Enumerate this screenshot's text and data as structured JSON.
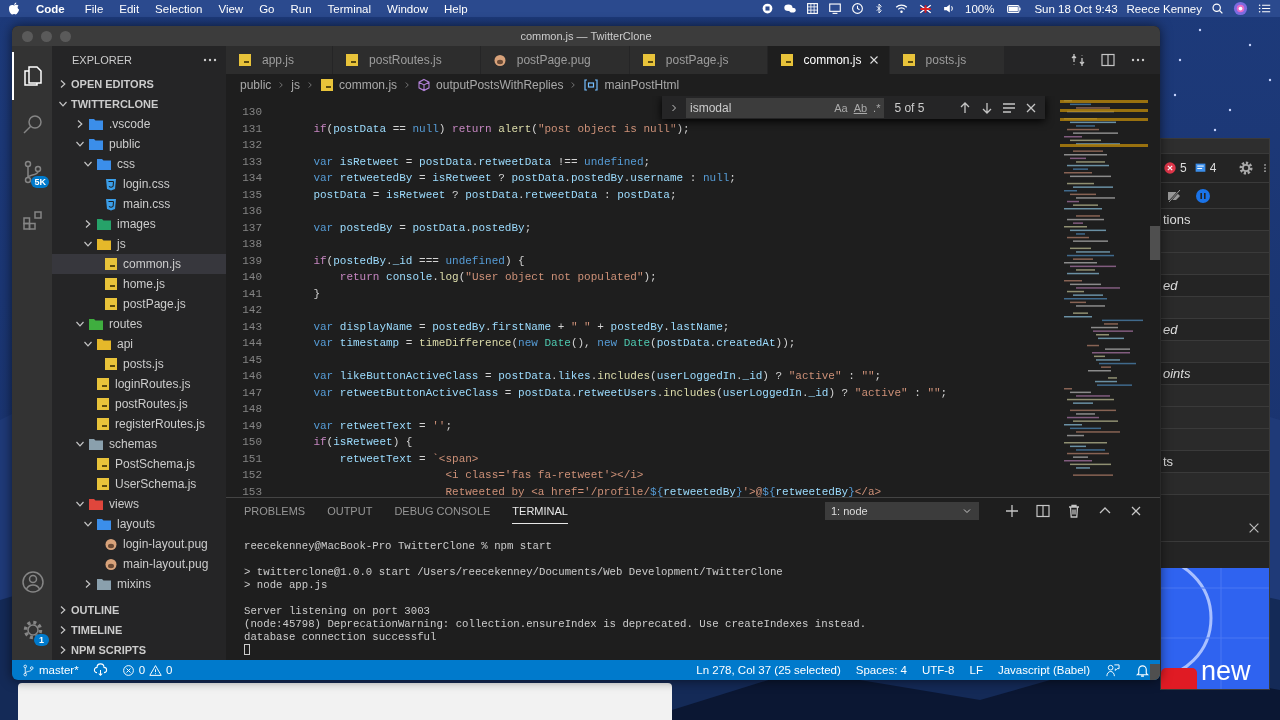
{
  "menubar": {
    "app_name": "Code",
    "menus": [
      "File",
      "Edit",
      "Selection",
      "View",
      "Go",
      "Run",
      "Terminal",
      "Window",
      "Help"
    ],
    "battery": "100%",
    "clock": "Sun 18 Oct 9:43",
    "user": "Reece Kenney"
  },
  "window": {
    "title": "common.js — TwitterClone"
  },
  "activity_bar": {
    "items": [
      {
        "kind": "explorer",
        "selected": true
      },
      {
        "kind": "search",
        "selected": false
      },
      {
        "kind": "source-control",
        "selected": false,
        "badge": "5K"
      },
      {
        "kind": "extensions",
        "selected": false
      }
    ],
    "settings_badge": "1"
  },
  "sidebar": {
    "title": "EXPLORER",
    "sections": [
      {
        "label": "OPEN EDITORS",
        "expanded": false
      },
      {
        "label": "TWITTERCLONE",
        "expanded": true,
        "tree": [
          {
            "name": ".vscode",
            "kind": "folder",
            "color": "#3b8eea",
            "expanded": false,
            "selected": false
          },
          {
            "name": "public",
            "kind": "folder",
            "color": "#3b8eea",
            "expanded": true,
            "selected": false,
            "children": [
              {
                "name": "css",
                "kind": "folder",
                "color": "#3b8eea",
                "expanded": true,
                "selected": false,
                "children": [
                  {
                    "name": "login.css",
                    "kind": "css",
                    "selected": false
                  },
                  {
                    "name": "main.css",
                    "kind": "css",
                    "selected": false
                  }
                ]
              },
              {
                "name": "images",
                "kind": "folder",
                "color": "#26a269",
                "expanded": false,
                "selected": false
              },
              {
                "name": "js",
                "kind": "folder",
                "color": "#e5b82a",
                "expanded": true,
                "selected": false,
                "children": [
                  {
                    "name": "common.js",
                    "kind": "js",
                    "selected": true
                  },
                  {
                    "name": "home.js",
                    "kind": "js",
                    "selected": false
                  },
                  {
                    "name": "postPage.js",
                    "kind": "js",
                    "selected": false
                  }
                ]
              }
            ]
          },
          {
            "name": "routes",
            "kind": "folder",
            "color": "#3fae3f",
            "expanded": true,
            "selected": false,
            "children": [
              {
                "name": "api",
                "kind": "folder",
                "color": "#e5b82a",
                "expanded": true,
                "selected": false,
                "children": [
                  {
                    "name": "posts.js",
                    "kind": "js",
                    "selected": false
                  }
                ]
              },
              {
                "name": "loginRoutes.js",
                "kind": "js",
                "selected": false
              },
              {
                "name": "postRoutes.js",
                "kind": "js",
                "selected": false
              },
              {
                "name": "registerRoutes.js",
                "kind": "js",
                "selected": false
              }
            ]
          },
          {
            "name": "schemas",
            "kind": "folder",
            "color": "#8aa0ad",
            "expanded": true,
            "selected": false,
            "children": [
              {
                "name": "PostSchema.js",
                "kind": "js",
                "selected": false
              },
              {
                "name": "UserSchema.js",
                "kind": "js",
                "selected": false
              }
            ]
          },
          {
            "name": "views",
            "kind": "folder",
            "color": "#e0463c",
            "expanded": true,
            "selected": false,
            "children": [
              {
                "name": "layouts",
                "kind": "folder",
                "color": "#3b8eea",
                "expanded": true,
                "selected": false,
                "children": [
                  {
                    "name": "login-layout.pug",
                    "kind": "pug",
                    "selected": false
                  },
                  {
                    "name": "main-layout.pug",
                    "kind": "pug",
                    "selected": false
                  }
                ]
              },
              {
                "name": "mixins",
                "kind": "folder",
                "color": "#8aa0ad",
                "expanded": false,
                "selected": false
              }
            ]
          }
        ]
      },
      {
        "label": "OUTLINE",
        "expanded": false
      },
      {
        "label": "TIMELINE",
        "expanded": false
      },
      {
        "label": "NPM SCRIPTS",
        "expanded": false
      }
    ]
  },
  "tabs": [
    {
      "label": "app.js",
      "kind": "js",
      "selected": false
    },
    {
      "label": "postRoutes.js",
      "kind": "js",
      "selected": false
    },
    {
      "label": "postPage.pug",
      "kind": "pug",
      "selected": false
    },
    {
      "label": "postPage.js",
      "kind": "js",
      "selected": false
    },
    {
      "label": "common.js",
      "kind": "js",
      "selected": true
    },
    {
      "label": "posts.js",
      "kind": "js",
      "selected": false
    }
  ],
  "breadcrumb": [
    {
      "label": "public",
      "kind": "folder"
    },
    {
      "label": "js",
      "kind": "folder"
    },
    {
      "label": "common.js",
      "kind": "js"
    },
    {
      "label": "outputPostsWithReplies",
      "kind": "method"
    },
    {
      "label": "mainPostHtml",
      "kind": "variable"
    }
  ],
  "find_widget": {
    "value": "ismodal",
    "options": [
      "Aa",
      "Ab",
      ".*"
    ],
    "match_count": "5 of 5"
  },
  "editor": {
    "lines": [
      {
        "n": "130"
      },
      {
        "n": "131",
        "tokens": [
          {
            "kind": "c",
            "text": "    if"
          },
          {
            "text": "("
          },
          {
            "kind": "v",
            "text": "postData"
          },
          {
            "text": " == "
          },
          {
            "kind": "k",
            "text": "null"
          },
          {
            "text": ") "
          },
          {
            "kind": "c",
            "text": "return "
          },
          {
            "kind": "f",
            "text": "alert"
          },
          {
            "text": "("
          },
          {
            "kind": "s",
            "text": "\"post object is null\""
          },
          {
            "text": ");"
          }
        ]
      },
      {
        "n": "132"
      },
      {
        "n": "133",
        "tokens": [
          {
            "kind": "k",
            "text": "    var "
          },
          {
            "kind": "v",
            "text": "isRetweet"
          },
          {
            "text": " = "
          },
          {
            "kind": "v",
            "text": "postData"
          },
          {
            "text": "."
          },
          {
            "kind": "v",
            "text": "retweetData"
          },
          {
            "text": " !== "
          },
          {
            "kind": "k",
            "text": "undefined"
          },
          {
            "text": ";"
          }
        ]
      },
      {
        "n": "134",
        "tokens": [
          {
            "kind": "k",
            "text": "    var "
          },
          {
            "kind": "v",
            "text": "retweetedBy"
          },
          {
            "text": " = "
          },
          {
            "kind": "v",
            "text": "isRetweet"
          },
          {
            "text": " ? "
          },
          {
            "kind": "v",
            "text": "postData"
          },
          {
            "text": "."
          },
          {
            "kind": "v",
            "text": "postedBy"
          },
          {
            "text": "."
          },
          {
            "kind": "v",
            "text": "username"
          },
          {
            "text": " : "
          },
          {
            "kind": "k",
            "text": "null"
          },
          {
            "text": ";"
          }
        ]
      },
      {
        "n": "135",
        "tokens": [
          {
            "kind": "v",
            "text": "    postData"
          },
          {
            "text": " = "
          },
          {
            "kind": "v",
            "text": "isRetweet"
          },
          {
            "text": " ? "
          },
          {
            "kind": "v",
            "text": "postData"
          },
          {
            "text": "."
          },
          {
            "kind": "v",
            "text": "retweetData"
          },
          {
            "text": " : "
          },
          {
            "kind": "v",
            "text": "postData"
          },
          {
            "text": ";"
          }
        ]
      },
      {
        "n": "136"
      },
      {
        "n": "137",
        "tokens": [
          {
            "kind": "k",
            "text": "    var "
          },
          {
            "kind": "v",
            "text": "postedBy"
          },
          {
            "text": " = "
          },
          {
            "kind": "v",
            "text": "postData"
          },
          {
            "text": "."
          },
          {
            "kind": "v",
            "text": "postedBy"
          },
          {
            "text": ";"
          }
        ]
      },
      {
        "n": "138"
      },
      {
        "n": "139",
        "tokens": [
          {
            "kind": "c",
            "text": "    if"
          },
          {
            "text": "("
          },
          {
            "kind": "v",
            "text": "postedBy"
          },
          {
            "text": "."
          },
          {
            "kind": "v",
            "text": "_id"
          },
          {
            "text": " === "
          },
          {
            "kind": "k",
            "text": "undefined"
          },
          {
            "text": ") {"
          }
        ]
      },
      {
        "n": "140",
        "tokens": [
          {
            "kind": "c",
            "text": "        return "
          },
          {
            "kind": "v",
            "text": "console"
          },
          {
            "text": "."
          },
          {
            "kind": "f",
            "text": "log"
          },
          {
            "text": "("
          },
          {
            "kind": "s",
            "text": "\"User object not populated\""
          },
          {
            "text": ");"
          }
        ]
      },
      {
        "n": "141",
        "tokens": [
          {
            "text": "    }"
          }
        ]
      },
      {
        "n": "142"
      },
      {
        "n": "143",
        "tokens": [
          {
            "kind": "k",
            "text": "    var "
          },
          {
            "kind": "v",
            "text": "displayName"
          },
          {
            "text": " = "
          },
          {
            "kind": "v",
            "text": "postedBy"
          },
          {
            "text": "."
          },
          {
            "kind": "v",
            "text": "firstName"
          },
          {
            "text": " + "
          },
          {
            "kind": "s",
            "text": "\" \""
          },
          {
            "text": " + "
          },
          {
            "kind": "v",
            "text": "postedBy"
          },
          {
            "text": "."
          },
          {
            "kind": "v",
            "text": "lastName"
          },
          {
            "text": ";"
          }
        ]
      },
      {
        "n": "144",
        "tokens": [
          {
            "kind": "k",
            "text": "    var "
          },
          {
            "kind": "v",
            "text": "timestamp"
          },
          {
            "text": " = "
          },
          {
            "kind": "f",
            "text": "timeDifference"
          },
          {
            "text": "("
          },
          {
            "kind": "k",
            "text": "new "
          },
          {
            "kind": "t",
            "text": "Date"
          },
          {
            "text": "(), "
          },
          {
            "kind": "k",
            "text": "new "
          },
          {
            "kind": "t",
            "text": "Date"
          },
          {
            "text": "("
          },
          {
            "kind": "v",
            "text": "postData"
          },
          {
            "text": "."
          },
          {
            "kind": "v",
            "text": "createdAt"
          },
          {
            "text": "));"
          }
        ]
      },
      {
        "n": "145"
      },
      {
        "n": "146",
        "tokens": [
          {
            "kind": "k",
            "text": "    var "
          },
          {
            "kind": "v",
            "text": "likeButtonActiveClass"
          },
          {
            "text": " = "
          },
          {
            "kind": "v",
            "text": "postData"
          },
          {
            "text": "."
          },
          {
            "kind": "v",
            "text": "likes"
          },
          {
            "text": "."
          },
          {
            "kind": "f",
            "text": "includes"
          },
          {
            "text": "("
          },
          {
            "kind": "v",
            "text": "userLoggedIn"
          },
          {
            "text": "."
          },
          {
            "kind": "v",
            "text": "_id"
          },
          {
            "text": ") ? "
          },
          {
            "kind": "s",
            "text": "\"active\""
          },
          {
            "text": " : "
          },
          {
            "kind": "s",
            "text": "\"\""
          },
          {
            "text": ";"
          }
        ]
      },
      {
        "n": "147",
        "tokens": [
          {
            "kind": "k",
            "text": "    var "
          },
          {
            "kind": "v",
            "text": "retweetButtonActiveClass"
          },
          {
            "text": " = "
          },
          {
            "kind": "v",
            "text": "postData"
          },
          {
            "text": "."
          },
          {
            "kind": "v",
            "text": "retweetUsers"
          },
          {
            "text": "."
          },
          {
            "kind": "f",
            "text": "includes"
          },
          {
            "text": "("
          },
          {
            "kind": "v",
            "text": "userLoggedIn"
          },
          {
            "text": "."
          },
          {
            "kind": "v",
            "text": "_id"
          },
          {
            "text": ") ? "
          },
          {
            "kind": "s",
            "text": "\"active\""
          },
          {
            "text": " : "
          },
          {
            "kind": "s",
            "text": "\"\""
          },
          {
            "text": ";"
          }
        ]
      },
      {
        "n": "148"
      },
      {
        "n": "149",
        "tokens": [
          {
            "kind": "k",
            "text": "    var "
          },
          {
            "kind": "v",
            "text": "retweetText"
          },
          {
            "text": " = "
          },
          {
            "kind": "s",
            "text": "''"
          },
          {
            "text": ";"
          }
        ]
      },
      {
        "n": "150",
        "tokens": [
          {
            "kind": "c",
            "text": "    if"
          },
          {
            "text": "("
          },
          {
            "kind": "v",
            "text": "isRetweet"
          },
          {
            "text": ") {"
          }
        ]
      },
      {
        "n": "151",
        "tokens": [
          {
            "kind": "v",
            "text": "        retweetText"
          },
          {
            "text": " = "
          },
          {
            "kind": "s",
            "text": "`<span>"
          }
        ]
      },
      {
        "n": "152",
        "tokens": [
          {
            "kind": "s",
            "text": "                        <i class='fas fa-retweet'></i>"
          }
        ]
      },
      {
        "n": "153",
        "tokens": [
          {
            "kind": "s",
            "text": "                        Retweeted by <a href='/profile/"
          },
          {
            "kind": "k",
            "text": "${"
          },
          {
            "kind": "v",
            "text": "retweetedBy"
          },
          {
            "kind": "k",
            "text": "}"
          },
          {
            "kind": "s",
            "text": "'>@"
          },
          {
            "kind": "k",
            "text": "${"
          },
          {
            "kind": "v",
            "text": "retweetedBy"
          },
          {
            "kind": "k",
            "text": "}"
          },
          {
            "kind": "s",
            "text": "</a>"
          }
        ]
      }
    ]
  },
  "panel": {
    "tabs": [
      {
        "label": "PROBLEMS",
        "selected": false
      },
      {
        "label": "OUTPUT",
        "selected": false
      },
      {
        "label": "DEBUG CONSOLE",
        "selected": false
      },
      {
        "label": "TERMINAL",
        "selected": true
      }
    ],
    "terminal_select": "1: node",
    "terminal_blocks": [
      [
        "reecekenney@MacBook-Pro TwitterClone % npm start"
      ],
      [
        "> twitterclone@1.0.0 start /Users/reecekenney/Documents/Web Development/TwitterClone",
        "> node app.js"
      ],
      [
        "Server listening on port 3003",
        "(node:45798) DeprecationWarning: collection.ensureIndex is deprecated. Use createIndexes instead.",
        "database connection successful"
      ]
    ]
  },
  "status_bar": {
    "branch": "master*",
    "errors": "0",
    "warnings": "0",
    "items": [
      "Ln 278, Col 37 (25 selected)",
      "Spaces: 4",
      "UTF-8",
      "LF",
      "Javascript (Babel)"
    ]
  },
  "devtools": {
    "errors": "5",
    "messages": "4",
    "rows": [
      {
        "label": "tions",
        "italic": false
      },
      {
        "label": "ed",
        "italic": true
      },
      {
        "label": "ed",
        "italic": true
      },
      {
        "label": "oints",
        "italic": true
      },
      {
        "label": "ts",
        "italic": false
      }
    ],
    "preview_text": "new"
  }
}
